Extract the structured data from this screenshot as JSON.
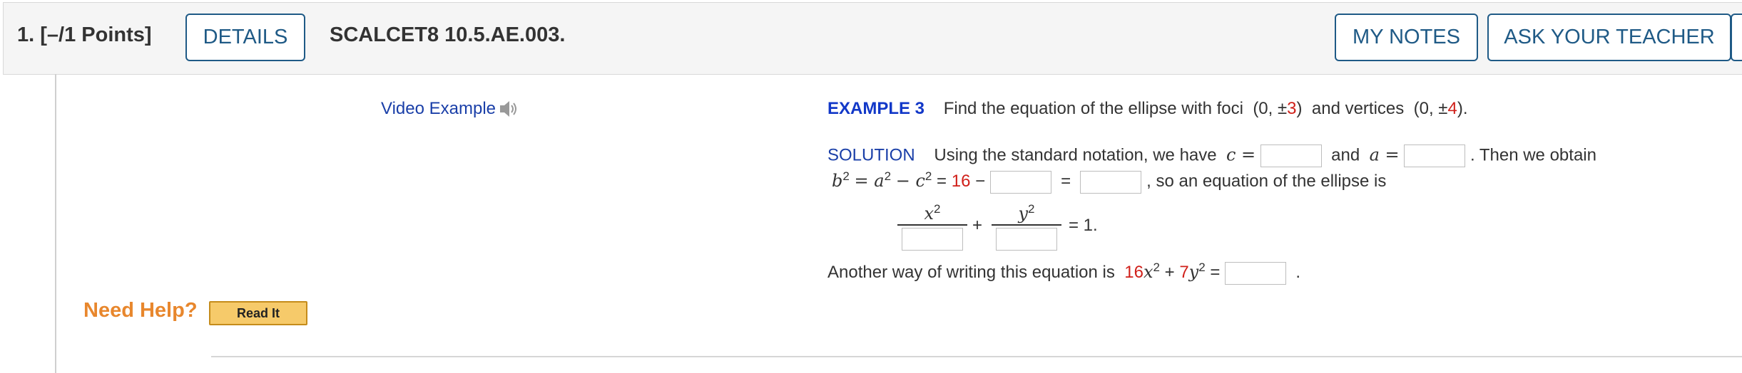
{
  "header": {
    "question": "1.  [–/1 Points]",
    "details_label": "DETAILS",
    "code": "SCALCET8 10.5.AE.003.",
    "my_notes_label": "MY NOTES",
    "ask_teacher_label": "ASK YOUR TEACHER"
  },
  "video": {
    "label": "Video Example"
  },
  "example": {
    "label": "EXAMPLE 3",
    "text": "Find the equation of the ellipse with foci",
    "foci_pre": "(0, ±",
    "foci_val": "3",
    "foci_post": ")",
    "and_vertices": "and vertices",
    "vert_pre": "(0, ±",
    "vert_val": "4",
    "vert_post": ")."
  },
  "solution": {
    "label": "SOLUTION",
    "text1": "Using the standard notation, we have",
    "c_eq": "c =",
    "and": "and",
    "a_eq": "a =",
    "then": ".  Then we obtain",
    "b2": "b",
    "eq2a": "= a",
    "eq2b": "− c",
    "eq2c": "=",
    "sixteen": "16",
    "minus": "−",
    "equals": "=",
    "so": ",  so an equation of the ellipse is",
    "x2": "x",
    "y2": "y",
    "plus": "+",
    "eq_one": "= 1.",
    "another": "Another way of writing this equation is",
    "coef16": "16",
    "x_sq": "x",
    "plus2": "+",
    "coef7": "7",
    "y_sq": "y",
    "eq3": "=",
    "period": "."
  },
  "help": {
    "label": "Need Help?",
    "read_it": "Read It"
  }
}
